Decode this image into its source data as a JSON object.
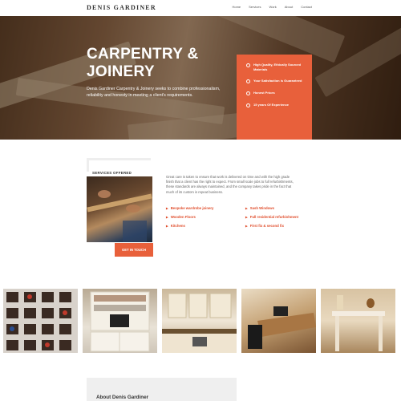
{
  "nav": {
    "logo": "DENIS GARDINER",
    "items": [
      "Home",
      "Services",
      "Work",
      "About",
      "Contact"
    ]
  },
  "hero": {
    "title_line1": "CARPENTRY &",
    "title_line2": "JOINERY",
    "text": "Denis Gardiner Carpentry & Joinery seeks to combine professionalism, reliability and honesty in meeting a client's requirements.",
    "features": [
      "High Quality, Ethically Sourced Materials",
      "Your Satisfaction is Guaranteed",
      "Honest Prices",
      "15 years Of Experience"
    ]
  },
  "services": {
    "tab_label": "SERVICES OFFERED",
    "description": "Great care is taken to ensure that work is delivered on time and with the high grade finish that a client has the right to expect. From small scale jobs to full refurbishments, these standards are always maintained, and the company takes pride in the fact that much of its custom is repeat business.",
    "col1": [
      "Bespoke wardrobe joinery",
      "Wooden Floors",
      "Kitchens"
    ],
    "col2": [
      "Sash Windows",
      "Full residential refurbishment",
      "First fix & second fix"
    ],
    "button": "GET IN TOUCH"
  },
  "about": {
    "title": "About Denis Gardiner"
  },
  "colors": {
    "accent": "#e8603b",
    "list_text": "#e04c2a"
  }
}
